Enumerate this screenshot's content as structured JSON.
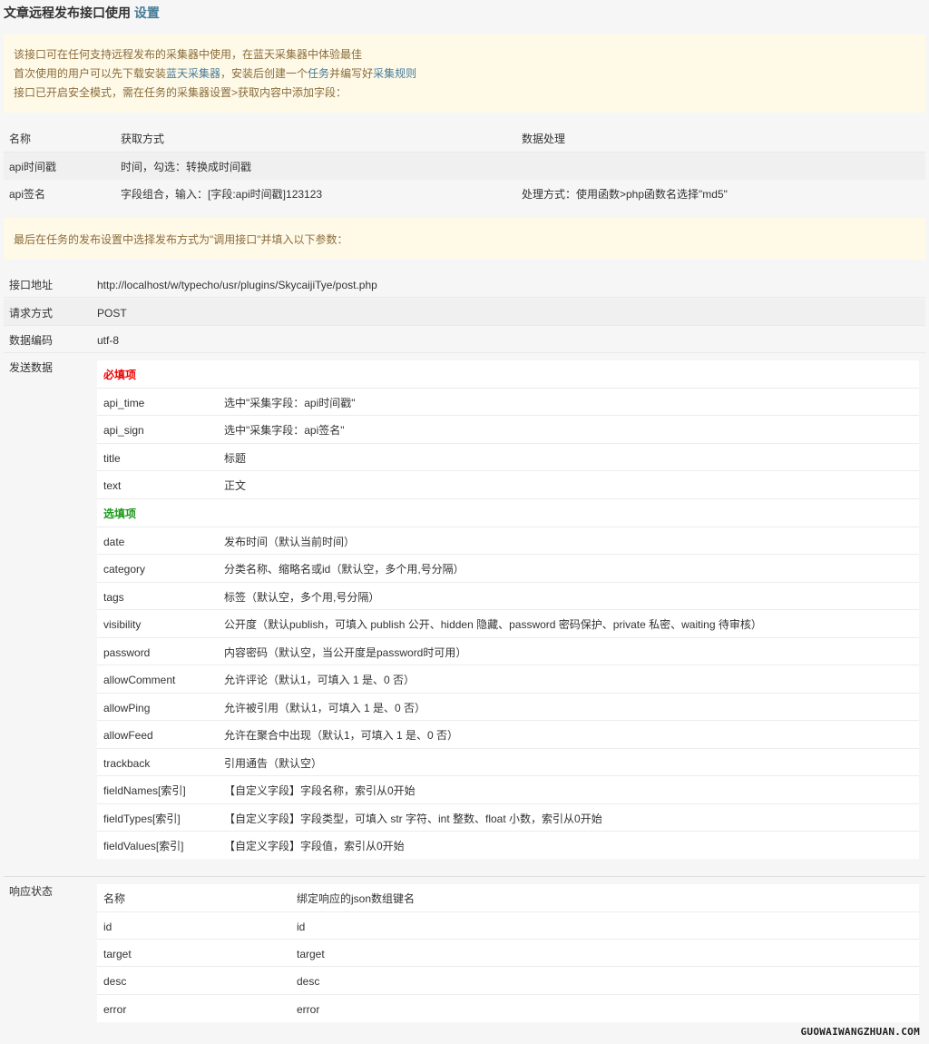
{
  "header": {
    "title": "文章远程发布接口使用",
    "settings_link": "设置"
  },
  "notice1": {
    "line1": "该接口可在任何支持远程发布的采集器中使用，在蓝天采集器中体验最佳",
    "line2_a": "首次使用的用户可以先下载安装",
    "line2_link1": "蓝天采集器",
    "line2_b": "，安装后创建一个",
    "line2_link2": "任务",
    "line2_c": "并编写好",
    "line2_link3": "采集规则",
    "line3": "接口已开启安全模式，需在任务的采集器设置>获取内容中添加字段："
  },
  "fields_table": {
    "headers": {
      "name": "名称",
      "method": "获取方式",
      "process": "数据处理"
    },
    "rows": [
      {
        "name": "api时间戳",
        "method": "时间，勾选：转换成时间戳",
        "process": ""
      },
      {
        "name": "api签名",
        "method": "字段组合，输入：[字段:api时间戳]123123",
        "process": "处理方式：使用函数>php函数名选择\"md5\""
      }
    ]
  },
  "notice2": {
    "text": "最后在任务的发布设置中选择发布方式为\"调用接口\"并填入以下参数："
  },
  "params": {
    "url_label": "接口地址",
    "url_value": "http://localhost/w/typecho/usr/plugins/SkycaijiTye/post.php",
    "method_label": "请求方式",
    "method_value": "POST",
    "encoding_label": "数据编码",
    "encoding_value": "utf-8",
    "send_label": "发送数据",
    "required_title": "必填项",
    "required": [
      {
        "key": "api_time",
        "desc": "选中\"采集字段：api时间戳\""
      },
      {
        "key": "api_sign",
        "desc": "选中\"采集字段：api签名\""
      },
      {
        "key": "title",
        "desc": "标题"
      },
      {
        "key": "text",
        "desc": "正文"
      }
    ],
    "optional_title": "选填项",
    "optional": [
      {
        "key": "date",
        "desc": "发布时间（默认当前时间）"
      },
      {
        "key": "category",
        "desc": "分类名称、缩略名或id（默认空，多个用,号分隔）"
      },
      {
        "key": "tags",
        "desc": "标签（默认空，多个用,号分隔）"
      },
      {
        "key": "visibility",
        "desc": "公开度（默认publish，可填入 publish 公开、hidden 隐藏、password 密码保护、private 私密、waiting 待审核）"
      },
      {
        "key": "password",
        "desc": "内容密码（默认空，当公开度是password时可用）"
      },
      {
        "key": "allowComment",
        "desc": "允许评论（默认1，可填入 1 是、0 否）"
      },
      {
        "key": "allowPing",
        "desc": "允许被引用（默认1，可填入 1 是、0 否）"
      },
      {
        "key": "allowFeed",
        "desc": "允许在聚合中出现（默认1，可填入 1 是、0 否）"
      },
      {
        "key": "trackback",
        "desc": "引用通告（默认空）"
      },
      {
        "key": "fieldNames[索引]",
        "desc": "【自定义字段】字段名称，索引从0开始"
      },
      {
        "key": "fieldTypes[索引]",
        "desc": "【自定义字段】字段类型，可填入 str 字符、int 整数、float 小数，索引从0开始"
      },
      {
        "key": "fieldValues[索引]",
        "desc": "【自定义字段】字段值，索引从0开始"
      }
    ],
    "response_label": "响应状态",
    "response_headers": {
      "name": "名称",
      "bind": "绑定响应的json数组键名"
    },
    "response": [
      {
        "name": "id",
        "bind": "id"
      },
      {
        "name": "target",
        "bind": "target"
      },
      {
        "name": "desc",
        "bind": "desc"
      },
      {
        "name": "error",
        "bind": "error"
      }
    ]
  },
  "watermark": "GUOWAIWANGZHUAN.COM",
  "colors": {
    "accent": "#467b96",
    "notice_bg": "#fff9e8",
    "notice_text": "#8a6d3b",
    "required": "#e00000",
    "optional": "#1a9a1a"
  }
}
